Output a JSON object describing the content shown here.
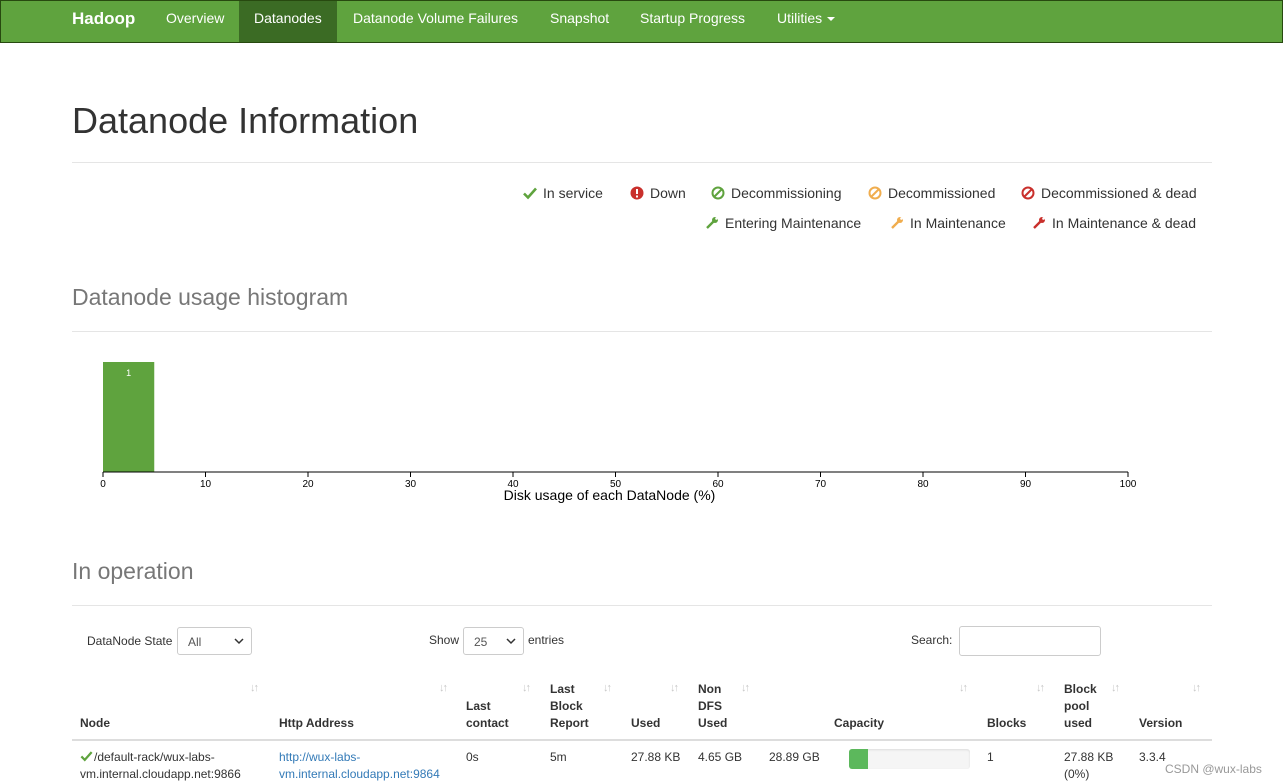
{
  "nav": {
    "brand": "Hadoop",
    "items": [
      {
        "label": "Overview",
        "active": false
      },
      {
        "label": "Datanodes",
        "active": true
      },
      {
        "label": "Datanode Volume Failures",
        "active": false
      },
      {
        "label": "Snapshot",
        "active": false
      },
      {
        "label": "Startup Progress",
        "active": false
      },
      {
        "label": "Utilities",
        "active": false
      }
    ]
  },
  "page_title": "Datanode Information",
  "legend": [
    {
      "label": "In service",
      "icon": "check-icon",
      "color": "#5fa33e"
    },
    {
      "label": "Down",
      "icon": "exclamation-circle-icon",
      "color": "#c9302c"
    },
    {
      "label": "Decommissioning",
      "icon": "ban-circle-icon",
      "color": "#5fa33e"
    },
    {
      "label": "Decommissioned",
      "icon": "ban-circle-icon",
      "color": "#f0ad4e"
    },
    {
      "label": "Decommissioned & dead",
      "icon": "ban-circle-icon",
      "color": "#c9302c"
    },
    {
      "label": "Entering Maintenance",
      "icon": "wrench-icon",
      "color": "#5fa33e"
    },
    {
      "label": "In Maintenance",
      "icon": "wrench-icon",
      "color": "#f0ad4e"
    },
    {
      "label": "In Maintenance & dead",
      "icon": "wrench-icon",
      "color": "#c9302c"
    }
  ],
  "histogram_title": "Datanode usage histogram",
  "chart_data": {
    "type": "bar",
    "bins": [
      {
        "x0": 0,
        "x1": 5,
        "count": 1
      }
    ],
    "xlabel": "Disk usage of each DataNode (%)",
    "xlim": [
      0,
      100
    ],
    "xticks": [
      "0",
      "10",
      "20",
      "30",
      "40",
      "50",
      "60",
      "70",
      "80",
      "90",
      "100"
    ],
    "bar_color": "#5fa33e"
  },
  "in_operation_title": "In operation",
  "controls": {
    "state_label": "DataNode State",
    "state_value": "All",
    "show_label": "Show",
    "show_value": "25",
    "entries_label": "entries",
    "search_label": "Search:",
    "search_value": ""
  },
  "table": {
    "headers": [
      "Node",
      "Http Address",
      "Last\ncontact",
      "Last\nBlock\nReport",
      "Used",
      "Non\nDFS\nUsed",
      "Capacity",
      "Blocks",
      "Block\npool\nused",
      "Version"
    ],
    "rows": [
      {
        "node": "/default-rack/wux-labs-\nvm.internal.cloudapp.net:9866",
        "http_address": "http://wux-labs-\nvm.internal.cloudapp.net:9864",
        "last_contact": "0s",
        "last_block_report": "5m",
        "used": "27.88 KB",
        "non_dfs_used": "4.65 GB",
        "capacity": "28.89 GB",
        "capacity_used_percent": 16,
        "blocks": "1",
        "block_pool_used": "27.88 KB\n(0%)",
        "version": "3.3.4",
        "status_icon": "check-icon"
      }
    ]
  },
  "watermark": "CSDN @wux-labs"
}
